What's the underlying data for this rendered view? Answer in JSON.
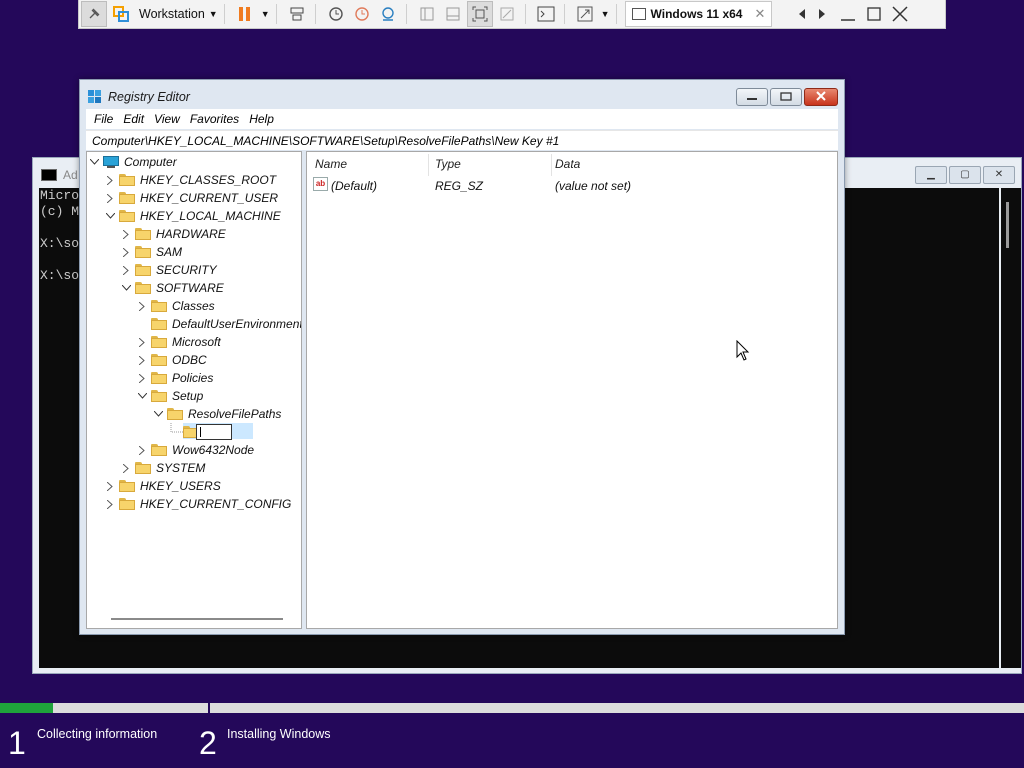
{
  "vmware_toolbar": {
    "vm_menu_label": "Workstation",
    "vm_tab_label": "Windows 11 x64",
    "vm_tab_close": "✕"
  },
  "cmd_window": {
    "title": "Ad",
    "lines": [
      "Micro",
      "(c) M",
      "",
      "X:\\so",
      "",
      "X:\\so"
    ]
  },
  "regedit": {
    "title": "Registry Editor",
    "menu": [
      "File",
      "Edit",
      "View",
      "Favorites",
      "Help"
    ],
    "address": "Computer\\HKEY_LOCAL_MACHINE\\SOFTWARE\\Setup\\ResolveFilePaths\\New Key #1",
    "tree": {
      "root": "Computer",
      "hkcr": "HKEY_CLASSES_ROOT",
      "hkcu": "HKEY_CURRENT_USER",
      "hklm": "HKEY_LOCAL_MACHINE",
      "hardware": "HARDWARE",
      "sam": "SAM",
      "security": "SECURITY",
      "software": "SOFTWARE",
      "classes": "Classes",
      "default_user_env": "DefaultUserEnvironment",
      "microsoft": "Microsoft",
      "odbc": "ODBC",
      "policies": "Policies",
      "setup": "Setup",
      "resolve_file_paths": "ResolveFilePaths",
      "wow6432": "Wow6432Node",
      "system": "SYSTEM",
      "hku": "HKEY_USERS",
      "hkcc": "HKEY_CURRENT_CONFIG"
    },
    "list_headers": {
      "name": "Name",
      "type": "Type",
      "data": "Data"
    },
    "values": [
      {
        "name": "(Default)",
        "type": "REG_SZ",
        "data": "(value not set)"
      }
    ]
  },
  "setup_progress": {
    "fill_fraction": 0.052,
    "step1_num": "1",
    "step1_label": "Collecting information",
    "step2_num": "2",
    "step2_label": "Installing Windows"
  },
  "colors": {
    "desktop": "#24085a",
    "progress": "#1fa33b",
    "cmd_bg": "#0c0c0c"
  }
}
